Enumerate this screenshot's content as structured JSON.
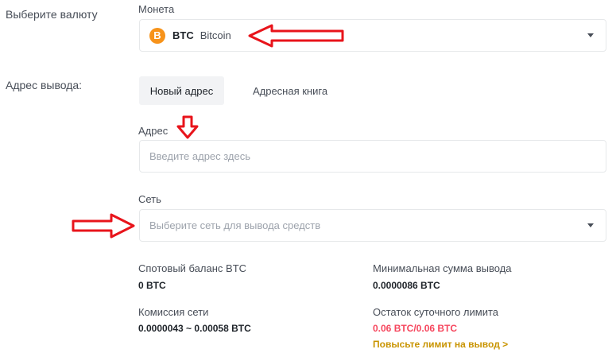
{
  "currency_row": {
    "label": "Выберите валюту",
    "field_label": "Монета",
    "coin_icon_glyph": "B",
    "coin_icon_color": "#f7931a",
    "coin_symbol": "BTC",
    "coin_name": "Bitcoin"
  },
  "address_row": {
    "label": "Адрес вывода:",
    "tabs": [
      {
        "label": "Новый адрес",
        "active": true
      },
      {
        "label": "Адресная книга",
        "active": false
      }
    ],
    "address_field_label": "Адрес",
    "address_placeholder": "Введите адрес здесь",
    "network_field_label": "Сеть",
    "network_placeholder": "Выберите сеть для вывода средств"
  },
  "info": {
    "spot_balance_label": "Спотовый баланс BTC",
    "spot_balance_value": "0 BTC",
    "min_withdraw_label": "Минимальная сумма вывода",
    "min_withdraw_value": "0.0000086 BTC",
    "network_fee_label": "Комиссия сети",
    "network_fee_value": "0.0000043 ~ 0.00058 BTC",
    "daily_limit_label": "Остаток суточного лимита",
    "daily_limit_value": "0.06 BTC/0.06 BTC",
    "daily_limit_link": "Повысьте лимит на вывод >"
  },
  "colors": {
    "accent_yellow": "#c99400",
    "limit_red": "#f6465d",
    "annotation_red": "#e8141b"
  },
  "icons": [
    "bitcoin-icon",
    "caret-down-icon",
    "annotation-arrow-left-icon",
    "annotation-arrow-down-icon",
    "annotation-arrow-right-icon"
  ]
}
